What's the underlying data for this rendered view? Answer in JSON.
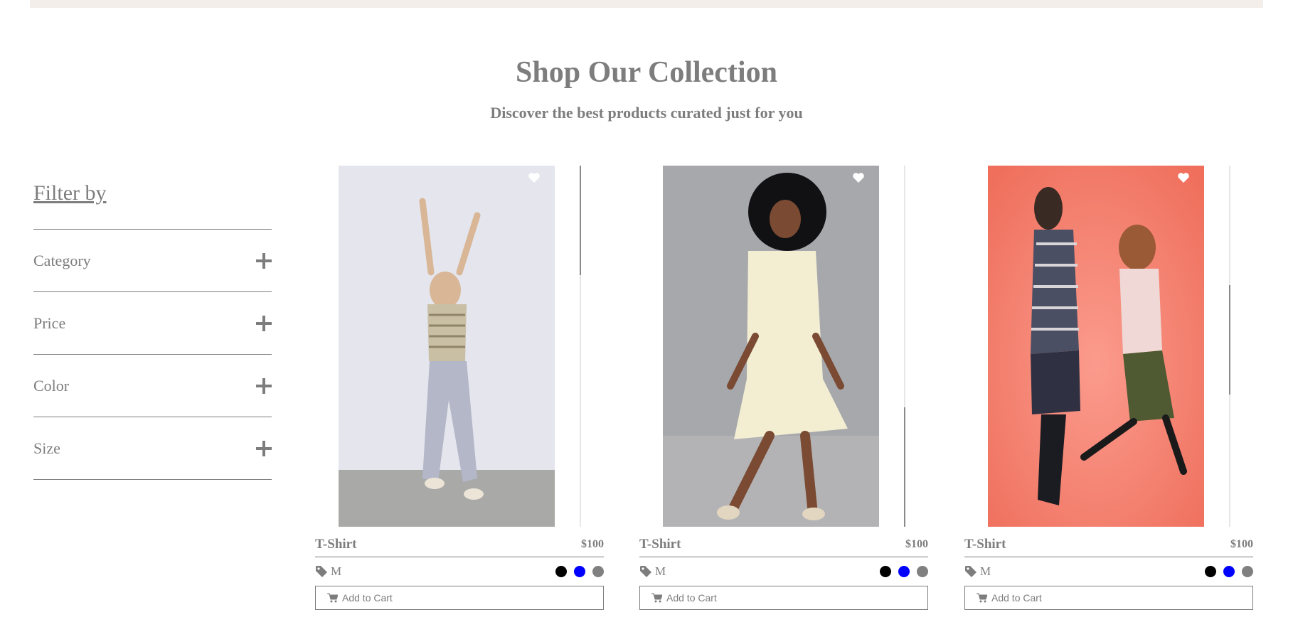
{
  "hero": {
    "title": "Shop Our Collection",
    "subtitle": "Discover the best products curated just for you"
  },
  "filter": {
    "title": "Filter by",
    "sections": [
      {
        "label": "Category",
        "icon": "plus-icon"
      },
      {
        "label": "Price",
        "icon": "plus-icon"
      },
      {
        "label": "Color",
        "icon": "plus-icon"
      },
      {
        "label": "Size",
        "icon": "plus-icon"
      }
    ]
  },
  "products": [
    {
      "name": "T-Shirt",
      "price": "$100",
      "size": "M",
      "add_to_cart": "Add to Cart",
      "image": "photo of a girl in a striped top and grey pants, arms raised",
      "favorite_icon": "heart-icon",
      "colors": [
        "#000000",
        "#0000ff",
        "#808080"
      ]
    },
    {
      "name": "T-Shirt",
      "price": "$100",
      "size": "M",
      "add_to_cart": "Add to Cart",
      "image": "photo of a girl in a cream dress dancing",
      "favorite_icon": "heart-icon",
      "colors": [
        "#000000",
        "#0000ff",
        "#808080"
      ]
    },
    {
      "name": "T-Shirt",
      "price": "$100",
      "size": "M",
      "add_to_cart": "Add to Cart",
      "image": "photo of two children walking on a coral pink background",
      "favorite_icon": "heart-icon",
      "colors": [
        "#000000",
        "#0000ff",
        "#808080"
      ]
    }
  ],
  "colors": {
    "text": "#7d7d7d",
    "top_band": "#f3eee9"
  }
}
